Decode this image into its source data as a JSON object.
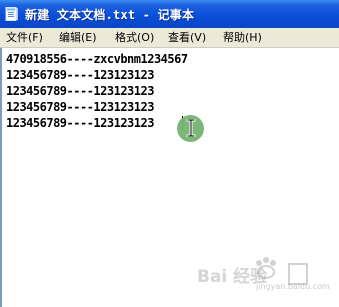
{
  "window": {
    "title": "新建 文本文档.txt - 记事本",
    "accent_color": "#0a4fd8"
  },
  "menu": {
    "items": [
      {
        "label": "文件(F)"
      },
      {
        "label": "编辑(E)"
      },
      {
        "label": "格式(O)"
      },
      {
        "label": "查看(V)"
      },
      {
        "label": "帮助(H)"
      }
    ]
  },
  "editor": {
    "lines": [
      "470918556----zxcvbnm1234567",
      "123456789----123123123",
      "123456789----123123123",
      "123456789----123123123",
      "123456789----123123123"
    ]
  },
  "watermark": {
    "text": "Bai 经验",
    "subtext": "jingyan.baidu.com"
  },
  "icons": {
    "app": "notepad-icon",
    "cursor": "text-cursor-icon"
  }
}
